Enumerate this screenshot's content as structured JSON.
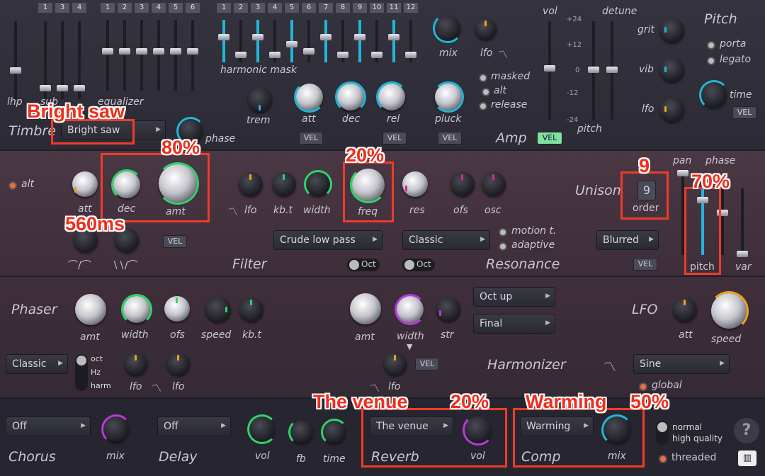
{
  "colors": {
    "accent_cyan": "#21b6d6",
    "accent_green": "#2ed36a",
    "accent_purple": "#b73ad6",
    "accent_orange": "#f0a020",
    "annotation_red": "#ee2e1e"
  },
  "timbre": {
    "section": "Timbre",
    "lhp": "lhp",
    "sub": "sub",
    "equalizer": "equalizer",
    "eq_tabs_a": [
      "1",
      "3",
      "4"
    ],
    "eq_tabs_b": [
      "1",
      "2",
      "3",
      "4",
      "5",
      "6"
    ],
    "waveform_select": "Bright saw",
    "phase": "phase"
  },
  "harmonic": {
    "tabs": [
      "1",
      "2",
      "3",
      "4",
      "5",
      "6",
      "7",
      "8",
      "9",
      "10",
      "11",
      "12"
    ],
    "label": "harmonic mask",
    "mix": "mix",
    "lfo": "lfo"
  },
  "amp": {
    "section": "Amp",
    "trem": "trem",
    "att": "att",
    "dec": "dec",
    "rel": "rel",
    "pluck": "pluck",
    "masked": "masked",
    "alt": "alt",
    "release": "release",
    "vel": "VEL"
  },
  "pitch": {
    "section": "Pitch",
    "vol": "vol",
    "detune": "detune",
    "pitch": "pitch",
    "scale": [
      "+24",
      "+12",
      "0",
      "-12",
      "-24"
    ],
    "grit": "grit",
    "vib": "vib",
    "lfo": "lfo",
    "porta": "porta",
    "legato": "legato",
    "time": "time",
    "vel": "VEL"
  },
  "filter": {
    "section": "Filter",
    "alt": "alt",
    "att": "att",
    "dec": "dec",
    "amt": "amt",
    "lfo": "lfo",
    "kbt": "kb.t",
    "width": "width",
    "freq": "freq",
    "res": "res",
    "ofs": "ofs",
    "osc": "osc",
    "type_select": "Crude low pass",
    "vel": "VEL",
    "oct": "Oct"
  },
  "resonance": {
    "section": "Resonance",
    "type_select": "Classic",
    "motion": "motion t.",
    "adaptive": "adaptive",
    "oct": "Oct"
  },
  "unison": {
    "section": "Unison",
    "order_value": "9",
    "order": "order",
    "pan": "pan",
    "phase": "phase",
    "pitch": "pitch",
    "var": "var",
    "blur_select": "Blurred",
    "vel": "VEL"
  },
  "phaser": {
    "section": "Phaser",
    "amt": "amt",
    "width": "width",
    "ofs": "ofs",
    "speed": "speed",
    "kbt": "kb.t",
    "type_select": "Classic",
    "oct": "oct",
    "hz": "Hz",
    "harm": "harm",
    "lfo1": "lfo",
    "lfo2": "lfo"
  },
  "harmonizer": {
    "section": "Harmonizer",
    "amt": "amt",
    "width": "width",
    "str": "str",
    "sel1": "Oct up",
    "sel2": "Final",
    "lfo": "lfo",
    "vel": "VEL"
  },
  "lfo": {
    "section": "LFO",
    "att": "att",
    "speed": "speed",
    "shape_select": "Sine",
    "global": "global"
  },
  "effects": {
    "chorus": "Chorus",
    "chorus_sel": "Off",
    "chorus_mix": "mix",
    "delay": "Delay",
    "delay_sel": "Off",
    "delay_vol": "vol",
    "delay_fb": "fb",
    "delay_time": "time",
    "reverb": "Reverb",
    "reverb_sel": "The venue",
    "reverb_vol": "vol",
    "comp": "Comp",
    "comp_sel": "Warming",
    "comp_mix": "mix",
    "normal": "normal",
    "high_quality": "high quality",
    "threaded": "threaded",
    "help": "?"
  },
  "annotations": {
    "bright_saw": "Bright saw",
    "filter_amt": "80%",
    "filter_dec": "560ms",
    "freq": "20%",
    "order": "9",
    "pitch": "70%",
    "reverb_name": "The venue",
    "reverb_vol": "20%",
    "comp_name": "Warming",
    "comp_mix": "50%"
  }
}
